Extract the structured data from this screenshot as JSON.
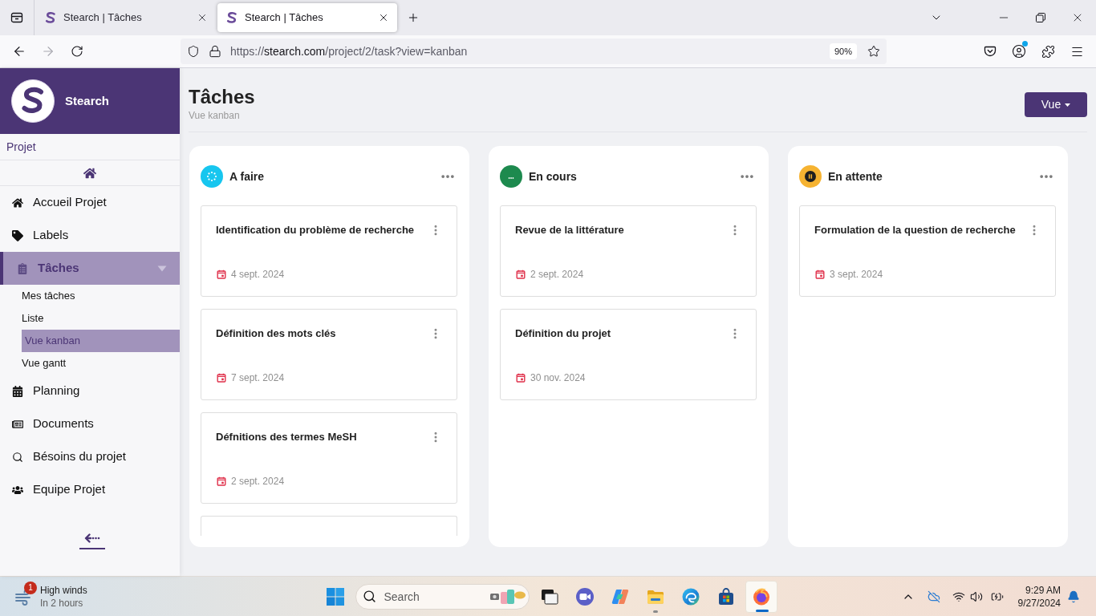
{
  "browser": {
    "tabs": [
      {
        "title": "Stearch | Tâches",
        "selected": false
      },
      {
        "title": "Stearch | Tâches",
        "selected": true
      }
    ],
    "forward_enabled": false,
    "url": {
      "scheme": "https://",
      "host": "stearch.com",
      "path": "/project/2/task?view=kanban"
    },
    "zoom": "90%",
    "account_badge": true
  },
  "sidebar": {
    "brand": "Stearch",
    "section": "Projet",
    "items": [
      {
        "label": "Accueil Projet",
        "selected": false
      },
      {
        "label": "Labels",
        "selected": false
      },
      {
        "label": "Tâches",
        "selected": true,
        "expanded": true,
        "children": [
          {
            "label": "Mes tâches",
            "selected": false
          },
          {
            "label": "Liste",
            "selected": false
          },
          {
            "label": "Vue kanban",
            "selected": true
          },
          {
            "label": "Vue gantt",
            "selected": false
          }
        ]
      },
      {
        "label": "Planning",
        "selected": false
      },
      {
        "label": "Documents",
        "selected": false
      },
      {
        "label": "Bésoins du projet",
        "selected": false
      },
      {
        "label": "Equipe Projet",
        "selected": false
      }
    ]
  },
  "page": {
    "title": "Tâches",
    "subtitle": "Vue kanban",
    "view_button": "Vue"
  },
  "columns": [
    {
      "title": "A faire",
      "kind": "todo",
      "color": "#17c6ef",
      "cards": [
        {
          "title": "Identification du problème de recherche",
          "date": "4 sept. 2024",
          "clipped": false
        },
        {
          "title": "Définition des mots clés",
          "date": "7 sept. 2024",
          "clipped": false
        },
        {
          "title": "Défnitions des termes MeSH",
          "date": "2 sept. 2024",
          "clipped": false
        },
        {
          "clipped": true
        }
      ]
    },
    {
      "title": "En cours",
      "kind": "in_progress",
      "color": "#1d8a4e",
      "cards": [
        {
          "title": "Revue de la littérature",
          "date": "2 sept. 2024",
          "clipped": false
        },
        {
          "title": "Définition du projet",
          "date": "30 nov. 2024",
          "clipped": false
        }
      ]
    },
    {
      "title": "En attente",
      "kind": "on_hold",
      "color": "#f6b331",
      "cards": [
        {
          "title": "Formulation de la question de recherche",
          "date": "3 sept. 2024",
          "clipped": false
        }
      ]
    }
  ],
  "taskbar": {
    "weather": {
      "badge": "1",
      "title": "High winds",
      "subtitle": "In 2 hours"
    },
    "search": {
      "placeholder": "Search"
    },
    "apps": [
      {
        "running": false,
        "selected": false
      },
      {
        "running": false,
        "selected": false
      },
      {
        "running": false,
        "selected": false
      },
      {
        "running": true,
        "selected": false
      },
      {
        "running": false,
        "selected": false
      },
      {
        "running": false,
        "selected": false
      },
      {
        "running": true,
        "selected": true
      }
    ],
    "clock": {
      "time": "9:29 AM",
      "date": "9/27/2024"
    }
  }
}
